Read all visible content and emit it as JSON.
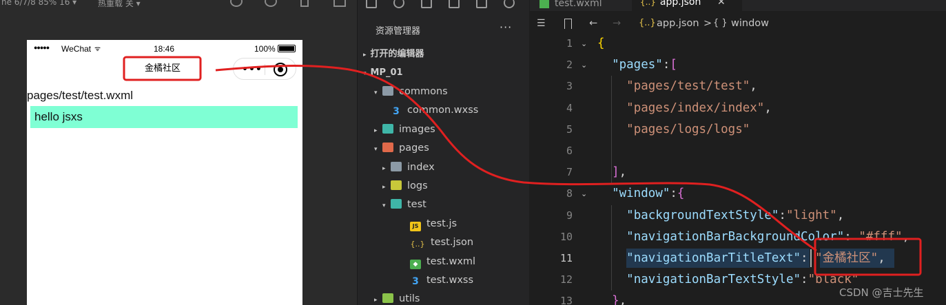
{
  "simulator": {
    "device_label": "ne 6/7/8 85% 16 ▾",
    "hot_reload_label": "热重载 关 ▾",
    "status": {
      "signal": "●●●●●",
      "carrier": "WeChat",
      "wifi": "ᯤ",
      "time": "18:46",
      "battery_pct": "100%",
      "battery_level": 1.0
    },
    "nav_title": "金橘社区",
    "capsule": {
      "dots": "•••"
    },
    "page_path": "pages/test/test.wxml",
    "content_text": "hello jsxs",
    "content_bg": "#7fffd4"
  },
  "explorer": {
    "title": "资源管理器",
    "more": "···",
    "open_editors_label": "打开的编辑器",
    "project_label": "MP_01",
    "tree": [
      {
        "label": "commons",
        "arrow": "▾",
        "icon": "folder-gray",
        "depth": 1
      },
      {
        "label": "common.wxss",
        "arrow": "",
        "icon": "css",
        "depth": 2
      },
      {
        "label": "images",
        "arrow": "▸",
        "icon": "folder-teal",
        "depth": 1
      },
      {
        "label": "pages",
        "arrow": "▾",
        "icon": "folder-red",
        "depth": 1
      },
      {
        "label": "index",
        "arrow": "▸",
        "icon": "folder-gray",
        "depth": 2
      },
      {
        "label": "logs",
        "arrow": "▸",
        "icon": "folder-yellow",
        "depth": 2
      },
      {
        "label": "test",
        "arrow": "▾",
        "icon": "folder-teal",
        "depth": 2
      },
      {
        "label": "test.js",
        "arrow": "",
        "icon": "js",
        "depth": 3
      },
      {
        "label": "test.json",
        "arrow": "",
        "icon": "json",
        "depth": 3
      },
      {
        "label": "test.wxml",
        "arrow": "",
        "icon": "wxml",
        "depth": 3
      },
      {
        "label": "test.wxss",
        "arrow": "",
        "icon": "css",
        "depth": 3
      },
      {
        "label": "utils",
        "arrow": "▸",
        "icon": "folder-green",
        "depth": 1
      }
    ]
  },
  "editor": {
    "tabs": [
      {
        "label": "test.wxml",
        "active": false
      },
      {
        "label": "app.json",
        "active": true,
        "close": "✕"
      }
    ],
    "breadcrumb": {
      "json_icon": "{..}",
      "file": "app.json",
      "sep": ">",
      "obj_icon": "{ }",
      "node": "window"
    },
    "current_line": 11,
    "lines": [
      {
        "num": "1",
        "fold": "⌄",
        "tokens": [
          [
            "b1",
            "{"
          ]
        ]
      },
      {
        "num": "2",
        "fold": "⌄",
        "tokens": [
          [
            "p",
            "  "
          ],
          [
            "k",
            "\"pages\""
          ],
          [
            "p",
            ":"
          ],
          [
            "b2",
            "["
          ]
        ]
      },
      {
        "num": "3",
        "fold": "",
        "tokens": [
          [
            "p",
            "    "
          ],
          [
            "s",
            "\"pages/test/test\""
          ],
          [
            "p",
            ","
          ]
        ]
      },
      {
        "num": "4",
        "fold": "",
        "tokens": [
          [
            "p",
            "    "
          ],
          [
            "s",
            "\"pages/index/index\""
          ],
          [
            "p",
            ","
          ]
        ]
      },
      {
        "num": "5",
        "fold": "",
        "tokens": [
          [
            "p",
            "    "
          ],
          [
            "s",
            "\"pages/logs/logs\""
          ]
        ]
      },
      {
        "num": "6",
        "fold": "",
        "tokens": []
      },
      {
        "num": "7",
        "fold": "",
        "tokens": [
          [
            "p",
            "  "
          ],
          [
            "b2",
            "]"
          ],
          [
            "p",
            ","
          ]
        ]
      },
      {
        "num": "8",
        "fold": "⌄",
        "tokens": [
          [
            "p",
            "  "
          ],
          [
            "k",
            "\"window\""
          ],
          [
            "p",
            ":"
          ],
          [
            "b2",
            "{"
          ]
        ]
      },
      {
        "num": "9",
        "fold": "",
        "tokens": [
          [
            "p",
            "    "
          ],
          [
            "k",
            "\"backgroundTextStyle\""
          ],
          [
            "p",
            ":"
          ],
          [
            "s",
            "\"light\""
          ],
          [
            "p",
            ","
          ]
        ]
      },
      {
        "num": "10",
        "fold": "",
        "tokens": [
          [
            "p",
            "    "
          ],
          [
            "k",
            "\"navigationBarBackgroundColor\""
          ],
          [
            "p",
            ": "
          ],
          [
            "s",
            "\"#fff\""
          ],
          [
            "p",
            ","
          ]
        ]
      },
      {
        "num": "11",
        "fold": "",
        "tokens": [
          [
            "p",
            "    "
          ],
          [
            "k",
            "\"navigationBarTitleText\""
          ],
          [
            "p",
            ": "
          ],
          [
            "s",
            "\"金橘社区\""
          ],
          [
            "p",
            ","
          ]
        ]
      },
      {
        "num": "12",
        "fold": "",
        "tokens": [
          [
            "p",
            "    "
          ],
          [
            "k",
            "\"navigationBarTextStyle\""
          ],
          [
            "p",
            ":"
          ],
          [
            "s",
            "\"black\""
          ]
        ]
      },
      {
        "num": "13",
        "fold": "",
        "tokens": [
          [
            "p",
            "  "
          ],
          [
            "b2",
            "}"
          ],
          [
            "p",
            ","
          ]
        ]
      }
    ]
  },
  "watermark": "CSDN @吉士先生",
  "colors": {
    "annotation_red": "#e02020",
    "editor_bg": "#1e1e1e",
    "sidebar_bg": "#252526"
  }
}
